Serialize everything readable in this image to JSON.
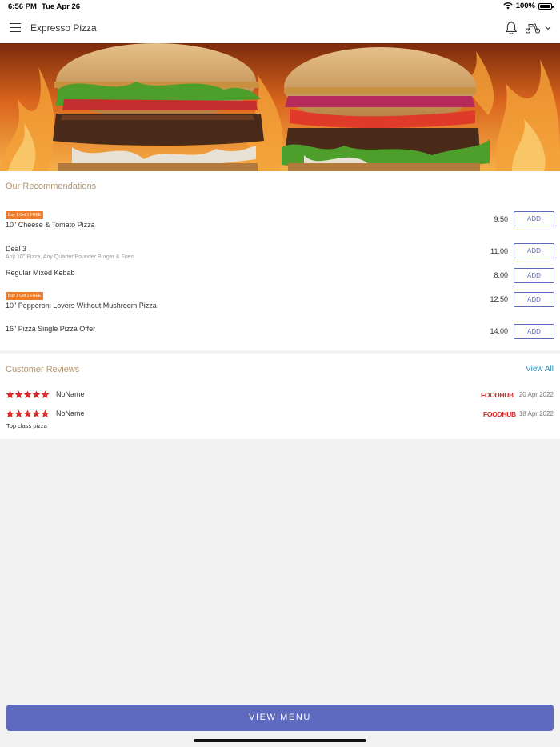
{
  "status_bar": {
    "time": "6:56 PM",
    "date": "Tue Apr 26",
    "battery": "100%"
  },
  "nav": {
    "title": "Expresso Pizza"
  },
  "recommendations": {
    "title": "Our Recommendations",
    "items": [
      {
        "badge": "Buy 1 Get 1 FREE",
        "name": "10\" Cheese & Tomato Pizza",
        "description": "",
        "price": "9.50",
        "add_label": "ADD"
      },
      {
        "badge": "",
        "name": "Deal 3",
        "description": "Any 10\" Pizza, Any Quarter Pounder Burger & Fries",
        "price": "11.00",
        "add_label": "ADD"
      },
      {
        "badge": "",
        "name": "Regular Mixed Kebab",
        "description": "",
        "price": "8.00",
        "add_label": "ADD"
      },
      {
        "badge": "Buy 1 Get 1 FREE",
        "name": "10\" Pepperoni Lovers Without Mushroom Pizza",
        "description": "",
        "price": "12.50",
        "add_label": "ADD"
      },
      {
        "badge": "",
        "name": "16\" Pizza Single Pizza Offer",
        "description": "",
        "price": "14.00",
        "add_label": "ADD"
      }
    ]
  },
  "reviews": {
    "title": "Customer Reviews",
    "view_all": "View All",
    "items": [
      {
        "rating": 5,
        "name": "NoName",
        "source": "FOODHUB",
        "date": "20 Apr 2022",
        "text": ""
      },
      {
        "rating": 5,
        "name": "NoName",
        "source": "FOODHUB",
        "date": "18 Apr 2022",
        "text": "Top class pizza"
      }
    ]
  },
  "footer": {
    "view_menu": "VIEW MENU"
  },
  "colors": {
    "accent": "#5e6abf",
    "badge": "#ef7c2a",
    "star": "#d52a2a",
    "section_title": "#b3956f",
    "link": "#2a8ab6"
  }
}
